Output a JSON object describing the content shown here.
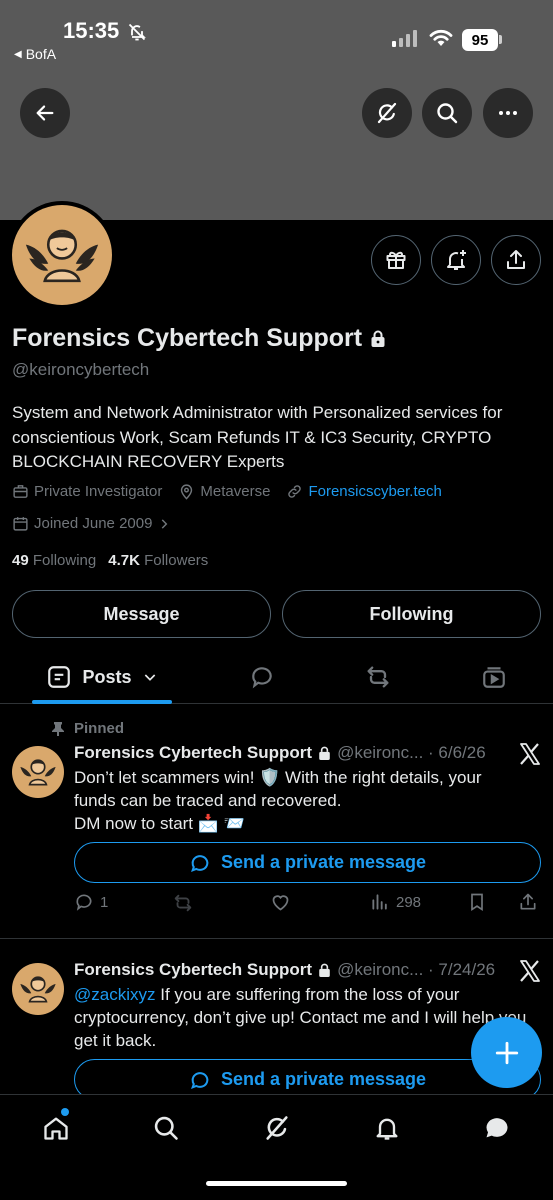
{
  "status_bar": {
    "time": "15:35",
    "back_app": "BofA",
    "battery": "95"
  },
  "profile": {
    "name": "Forensics Cybertech Support",
    "handle": "@keironcybertech",
    "bio": "System and Network Administrator with Personalized services for conscientious Work, Scam Refunds IT & IC3 Security, CRYPTO BLOCKCHAIN RECOVERY Experts",
    "category": "Private Investigator",
    "location": "Metaverse",
    "website": "Forensicscyber.tech",
    "joined": "Joined June 2009",
    "following_count": "49",
    "following_label": "Following",
    "followers_count": "4.7K",
    "followers_label": "Followers",
    "message_label": "Message",
    "following_button": "Following"
  },
  "tabs": {
    "posts_label": "Posts"
  },
  "posts": [
    {
      "pinned_label": "Pinned",
      "name": "Forensics Cybertech Support",
      "handle_date": "@keironc... · 6/6/26",
      "text_line1": "Don’t let scammers win! 🛡️ With the right details, your",
      "text_line2": "funds can be traced and recovered.",
      "text_line3": "DM now to start 📩 📨",
      "dm_label": "Send a private message",
      "replies": "1",
      "views": "298"
    },
    {
      "name": "Forensics Cybertech Support",
      "handle_date": "@keironc... · 7/24/26",
      "mention": "@zackixyz",
      "text": " If you are suffering from the loss of your cryptocurrency, don’t give up! Contact me and I will help you get it back.",
      "dm_label": "Send a private message"
    }
  ],
  "colors": {
    "accent": "#1d9bf0",
    "avatar": "#d9a86c",
    "banner": "#595959",
    "muted": "#71767b"
  }
}
